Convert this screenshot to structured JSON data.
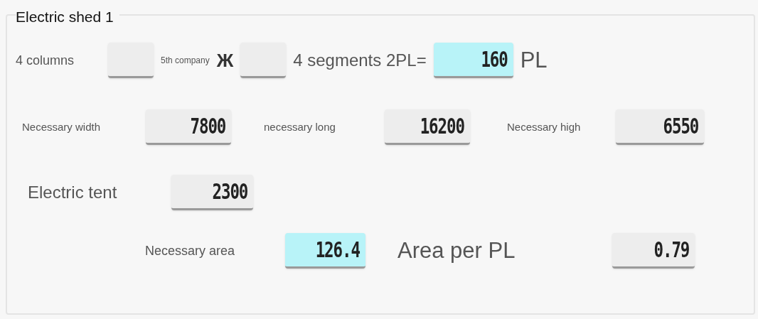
{
  "group": {
    "title": "Electric shed 1"
  },
  "row_1": [
    {
      "kind": "label",
      "text": "4 columns"
    },
    {
      "kind": "field",
      "highlighted": false
    },
    {
      "kind": "label",
      "text": "5th company"
    },
    {
      "kind": "symbol",
      "text": "Ж"
    },
    {
      "kind": "field",
      "highlighted": false
    },
    {
      "kind": "label",
      "text": "4 segments 2PL="
    },
    {
      "kind": "field",
      "value": "160",
      "highlighted": true
    },
    {
      "kind": "label",
      "text": "PL"
    }
  ],
  "row_2": [
    {
      "kind": "label",
      "text": "Necessary width"
    },
    {
      "kind": "field",
      "value": "7800",
      "highlighted": false
    },
    {
      "kind": "label",
      "text": "necessary long"
    },
    {
      "kind": "field",
      "value": "16200",
      "highlighted": false
    },
    {
      "kind": "label",
      "text": "Necessary high"
    },
    {
      "kind": "field",
      "value": "6550",
      "highlighted": false
    }
  ],
  "row_3": [
    {
      "kind": "label",
      "text": "Electric tent"
    },
    {
      "kind": "field",
      "value": "2300",
      "highlighted": false
    }
  ],
  "row_4": [
    {
      "kind": "label",
      "text": "Necessary area"
    },
    {
      "kind": "field",
      "value": "126.4",
      "highlighted": true
    },
    {
      "kind": "label",
      "text": "Area per PL"
    },
    {
      "kind": "field",
      "value": "0.79",
      "highlighted": false
    }
  ]
}
